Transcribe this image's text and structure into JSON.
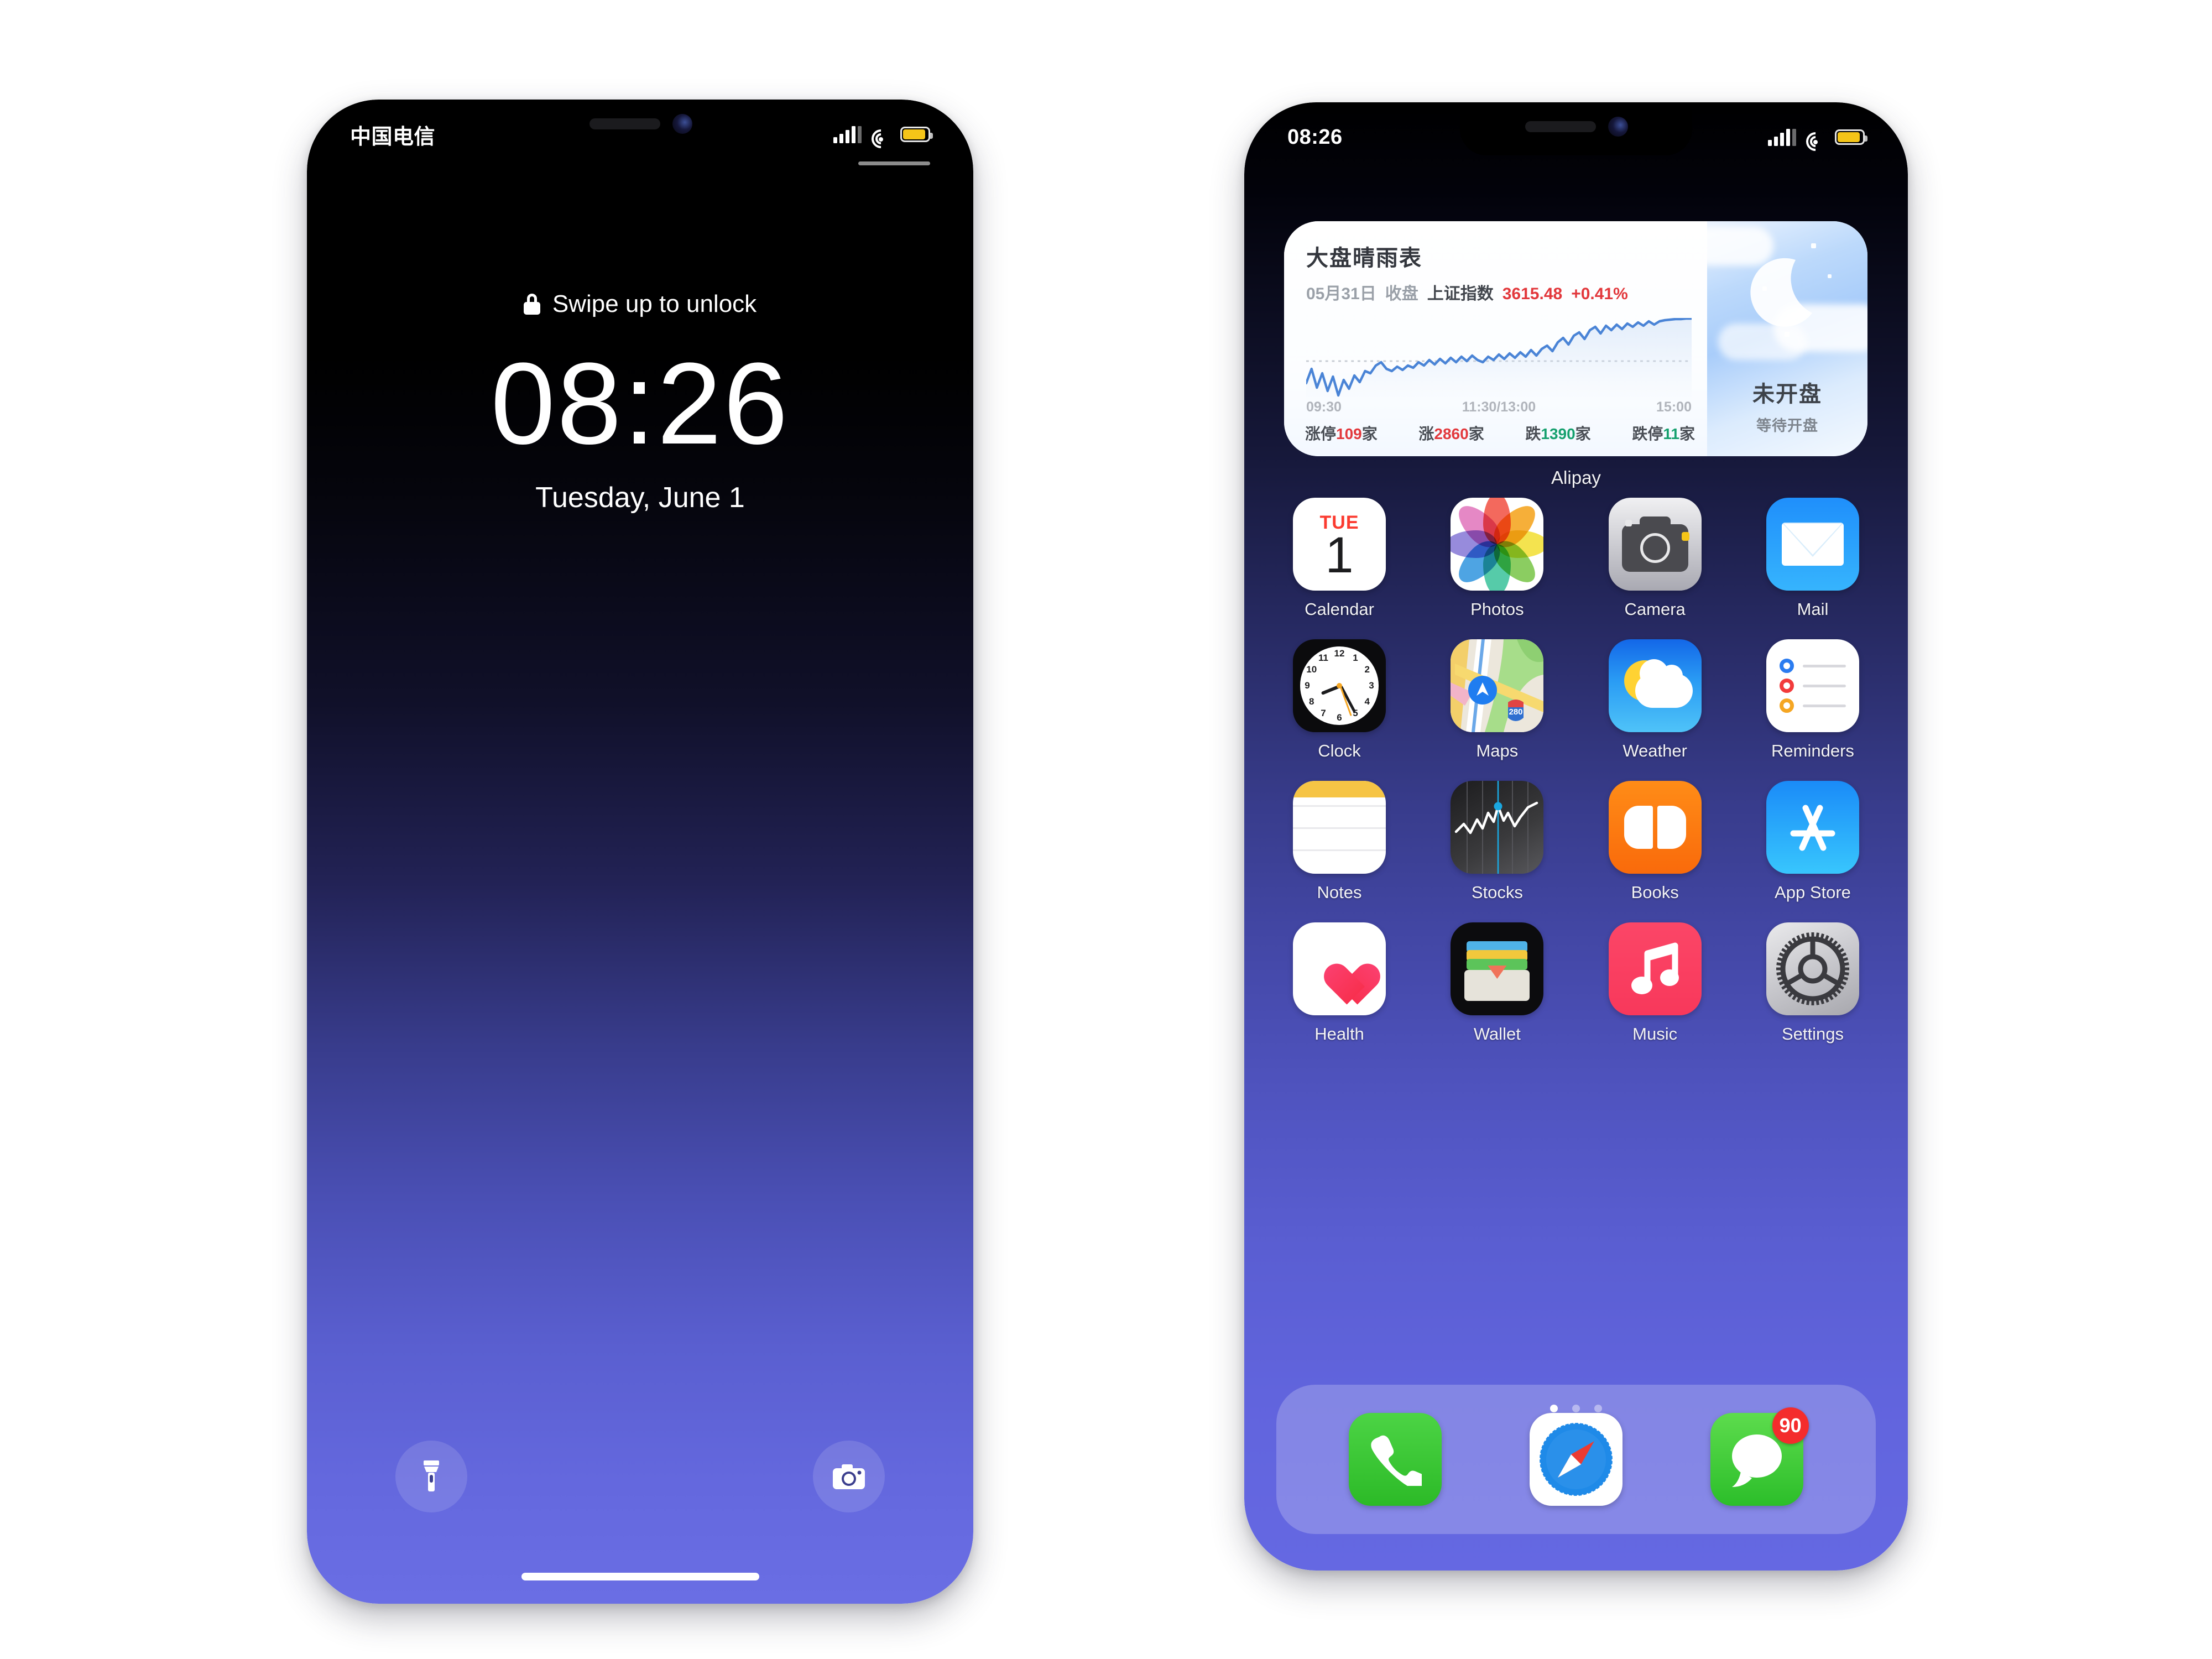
{
  "lock_screen": {
    "status_bar": {
      "carrier": "中国电信",
      "signal_icon": "signal-bars-icon",
      "wifi_icon": "wifi-icon",
      "battery_icon": "battery-icon"
    },
    "swipe_hint": "Swipe up to unlock",
    "lock_icon": "lock-icon",
    "time": "08:26",
    "date": "Tuesday, June 1",
    "flashlight_icon": "flashlight-icon",
    "camera_icon": "camera-icon"
  },
  "home_screen": {
    "status_bar": {
      "time": "08:26",
      "signal_icon": "signal-bars-icon",
      "wifi_icon": "wifi-icon",
      "battery_icon": "battery-icon"
    },
    "widget": {
      "title": "大盘晴雨表",
      "date": "05月31日",
      "session": "收盘",
      "index_name": "上证指数",
      "index_value": "3615.48",
      "index_change": "+0.41%",
      "axis": {
        "start": "09:30",
        "middle": "11:30/13:00",
        "end": "15:00"
      },
      "stats": [
        {
          "label": "涨停",
          "value": "109",
          "unit": "家",
          "color": "#e2383c"
        },
        {
          "label": "涨",
          "value": "2860",
          "unit": "家",
          "color": "#e2383c"
        },
        {
          "label": "跌",
          "value": "1390",
          "unit": "家",
          "color": "#16a06e"
        },
        {
          "label": "跌停",
          "value": "11",
          "unit": "家",
          "color": "#16a06e"
        }
      ],
      "side_status": "未开盘",
      "side_subtitle": "等待开盘",
      "side_icon": "moon-clouds-icon",
      "label": "Alipay"
    },
    "apps": [
      [
        {
          "name": "Calendar",
          "icon": "calendar-icon",
          "dow": "TUE",
          "day": "1"
        },
        {
          "name": "Photos",
          "icon": "photos-icon"
        },
        {
          "name": "Camera",
          "icon": "camera-icon"
        },
        {
          "name": "Mail",
          "icon": "mail-icon"
        }
      ],
      [
        {
          "name": "Clock",
          "icon": "clock-icon"
        },
        {
          "name": "Maps",
          "icon": "maps-icon",
          "route": "280"
        },
        {
          "name": "Weather",
          "icon": "weather-icon"
        },
        {
          "name": "Reminders",
          "icon": "reminders-icon"
        }
      ],
      [
        {
          "name": "Notes",
          "icon": "notes-icon"
        },
        {
          "name": "Stocks",
          "icon": "stocks-icon"
        },
        {
          "name": "Books",
          "icon": "books-icon"
        },
        {
          "name": "App Store",
          "icon": "app-store-icon"
        }
      ],
      [
        {
          "name": "Health",
          "icon": "health-icon"
        },
        {
          "name": "Wallet",
          "icon": "wallet-icon"
        },
        {
          "name": "Music",
          "icon": "music-icon"
        },
        {
          "name": "Settings",
          "icon": "settings-icon"
        }
      ]
    ],
    "page_dots": {
      "count": 3,
      "active_index": 0
    },
    "dock": [
      {
        "name": "Phone",
        "icon": "phone-icon"
      },
      {
        "name": "Safari",
        "icon": "safari-icon"
      },
      {
        "name": "Messages",
        "icon": "messages-icon",
        "badge": "90"
      }
    ]
  },
  "chart_data": {
    "type": "line",
    "title": "大盘晴雨表",
    "xlabel": "",
    "ylabel": "",
    "x": [
      "09:30",
      "11:30/13:00",
      "15:00"
    ],
    "series": [
      {
        "name": "上证指数",
        "values": [
          30,
          42,
          26,
          38,
          22,
          34,
          18,
          30,
          24,
          33,
          28,
          40,
          36,
          47,
          52,
          44,
          40,
          46,
          42,
          48,
          45,
          52,
          48,
          55,
          50,
          56,
          52,
          58,
          54,
          60,
          56,
          62,
          58,
          55,
          60,
          57,
          62,
          59,
          64,
          60,
          66,
          62,
          68,
          64,
          70,
          72,
          68,
          76,
          80,
          74,
          82,
          86,
          80,
          88,
          92,
          86,
          94,
          90,
          96,
          92,
          98,
          95,
          100,
          97,
          103,
          100,
          106,
          110,
          114,
          118,
          124,
          130
        ]
      }
    ],
    "reference_line": 58,
    "line_color": "#4a84d6",
    "close_value": 3615.48,
    "change_percent": 0.41,
    "grid": false,
    "legend": "none"
  }
}
